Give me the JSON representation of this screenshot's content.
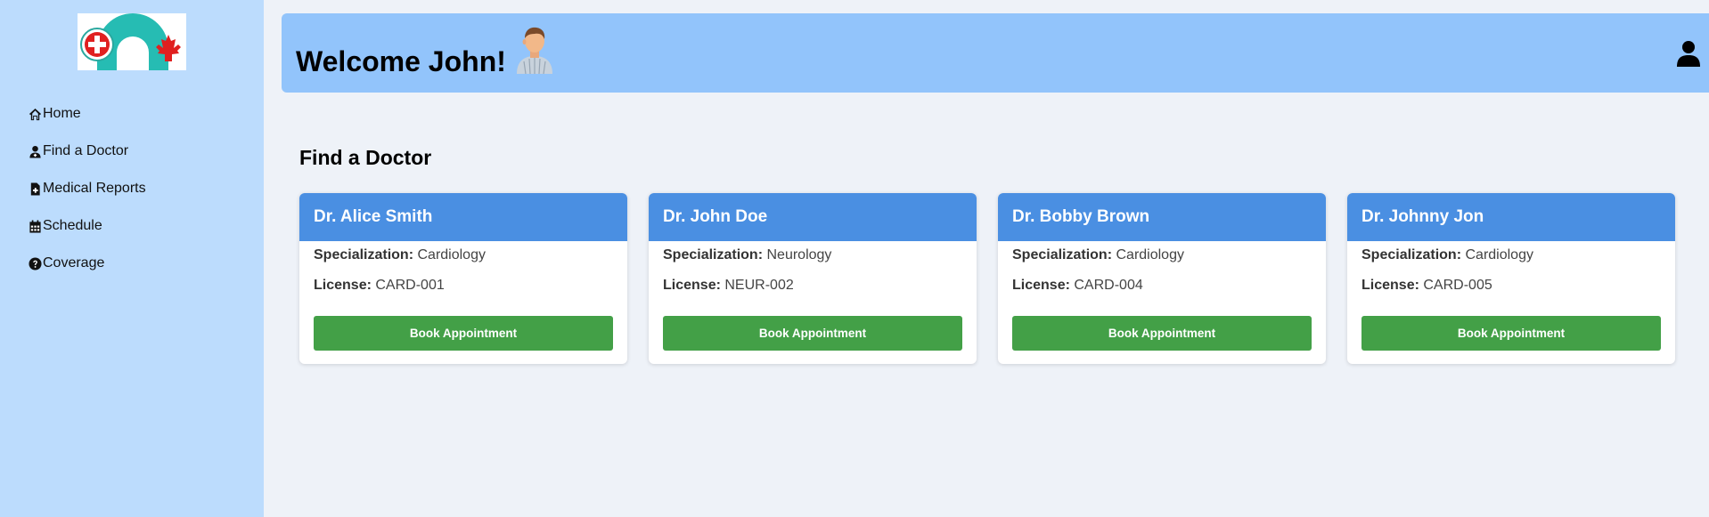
{
  "nav": {
    "items": [
      {
        "label": "Home",
        "icon": "home-icon"
      },
      {
        "label": "Find a Doctor",
        "icon": "user-doctor-icon"
      },
      {
        "label": "Medical Reports",
        "icon": "file-medical-icon"
      },
      {
        "label": "Schedule",
        "icon": "calendar-icon"
      },
      {
        "label": "Coverage",
        "icon": "question-circle-icon"
      }
    ]
  },
  "header": {
    "welcome": "Welcome John!"
  },
  "section": {
    "title": "Find a Doctor"
  },
  "labels": {
    "specialization": "Specialization:",
    "license": "License:",
    "book": "Book Appointment"
  },
  "doctors": [
    {
      "name": "Dr. Alice Smith",
      "specialization": "Cardiology",
      "license": "CARD-001"
    },
    {
      "name": "Dr. John Doe",
      "specialization": "Neurology",
      "license": "NEUR-002"
    },
    {
      "name": "Dr. Bobby Brown",
      "specialization": "Cardiology",
      "license": "CARD-004"
    },
    {
      "name": "Dr. Johnny Jon",
      "specialization": "Cardiology",
      "license": "CARD-005"
    }
  ],
  "colors": {
    "sidebar": "#bcdcfd",
    "header": "#92c4fb",
    "card_header": "#4a8fe2",
    "button": "#43a047",
    "background": "#eef2f8"
  }
}
